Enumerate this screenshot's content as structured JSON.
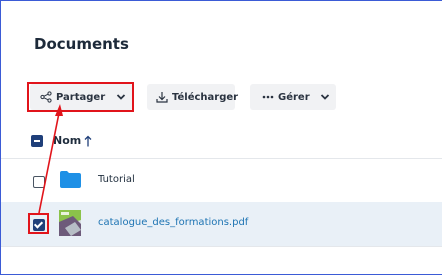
{
  "header": {
    "title": "Documents"
  },
  "toolbar": {
    "share_label": "Partager",
    "download_label": "Télécharger",
    "manage_label": "Gérer"
  },
  "list_header": {
    "name_label": "Nom"
  },
  "files": [
    {
      "name": "Tutorial",
      "type": "folder",
      "selected": false
    },
    {
      "name": "catalogue_des_formations.pdf",
      "type": "pdf",
      "selected": true
    }
  ],
  "colors": {
    "accent": "#1f3f7a",
    "highlight": "#e1141b",
    "link": "#1e74b3",
    "folder": "#1e90e6",
    "selected_row": "#e9f0f7"
  }
}
